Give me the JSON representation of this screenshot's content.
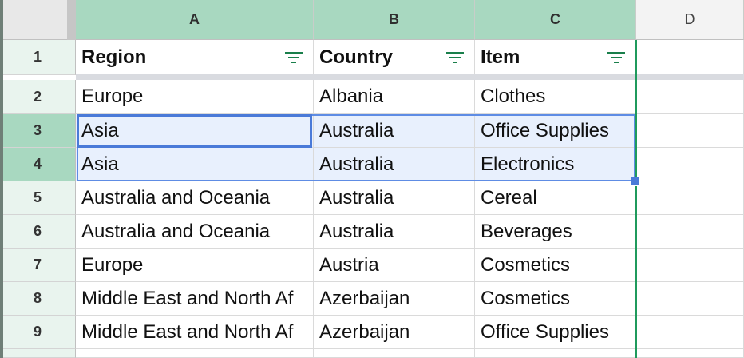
{
  "columns": [
    "A",
    "B",
    "C",
    "D"
  ],
  "rows": [
    "1",
    "2",
    "3",
    "4",
    "5",
    "6",
    "7",
    "8",
    "9"
  ],
  "headers": [
    "Region",
    "Country",
    "Item"
  ],
  "data": [
    [
      "Europe",
      "Albania",
      "Clothes"
    ],
    [
      "Asia",
      "Australia",
      "Office Supplies"
    ],
    [
      "Asia",
      "Australia",
      "Electronics"
    ],
    [
      "Australia and Oceania",
      "Australia",
      "Cereal"
    ],
    [
      "Australia and Oceania",
      "Australia",
      "Beverages"
    ],
    [
      "Europe",
      "Austria",
      "Cosmetics"
    ],
    [
      "Middle East and North Af",
      "Azerbaijan",
      "Cosmetics"
    ],
    [
      "Middle East and North Af",
      "Azerbaijan",
      "Office Supplies"
    ]
  ],
  "selected_rows": [
    "3",
    "4"
  ],
  "active_cell": "A3",
  "colors": {
    "selection_blue": "#4a7ad8",
    "header_selected": "#a8d8c0",
    "filter_green": "#1a7f4b"
  },
  "icons": {
    "filter": "filter-icon"
  }
}
